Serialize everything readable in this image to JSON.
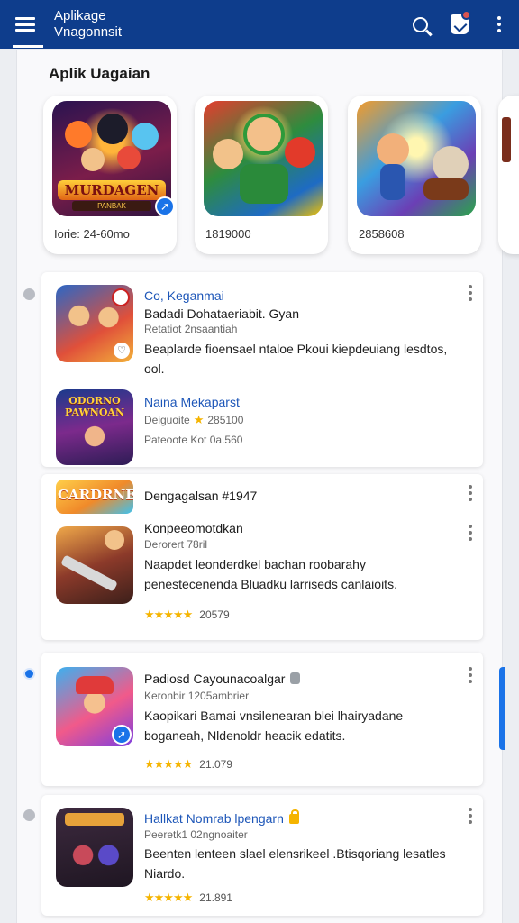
{
  "appbar": {
    "title_line1": "Aplikage",
    "title_line2": "Vnagonnsit"
  },
  "section": {
    "title": "Aplik Uagaian"
  },
  "featured": [
    {
      "banner": "MURDAGEN",
      "banner_sub": "PANBAK",
      "meta": "Iorie: 24-60mo"
    },
    {
      "meta": "1819000"
    },
    {
      "meta": "2858608"
    }
  ],
  "list": [
    {
      "title": "Co, Keganmai",
      "subtitle": "Badadi Dohataeriabit. Gyan",
      "meta": "Retatiot 2nsaantiah",
      "description": "Beaplarde fioensael ntaloe Pkoui kiepdeuiang lesdtos, ool."
    },
    {
      "title": "Naina Mekaparst",
      "meta_label": "Deiguoite",
      "meta_value": "285100",
      "meta2": "Pateoote Kot 0a.560",
      "icon_text": "ODORNO PAWNOAN"
    },
    {
      "title": "Dengagalsan #1947",
      "icon_text": "CARDRNE"
    },
    {
      "title": "Konpeeomotdkan",
      "meta": "Derorert 78ril",
      "description": "Naapdet leonderdkel bachan roobarahy penestecenenda Bluadku larriseds canlaioits.",
      "stars": "★★★★★",
      "rating": "20579"
    },
    {
      "title": "Padiosd Cayounacoalgar",
      "meta": "Keronbir 1205ambrier",
      "description": "Kaopikari Bamai vnsilenearan blei lhairyadane boganeah, Nldenoldr heacik edatits.",
      "stars": "★★★★★",
      "rating": "21.079"
    },
    {
      "title": "Hallkat Nomrab lpengarn",
      "meta": "Peeretk1 02ngnoaiter",
      "description": "Beenten lenteen slael elensrikeel .Btisqoriang lesatles Niardo.",
      "stars": "★★★★★",
      "rating": "21.891"
    }
  ]
}
